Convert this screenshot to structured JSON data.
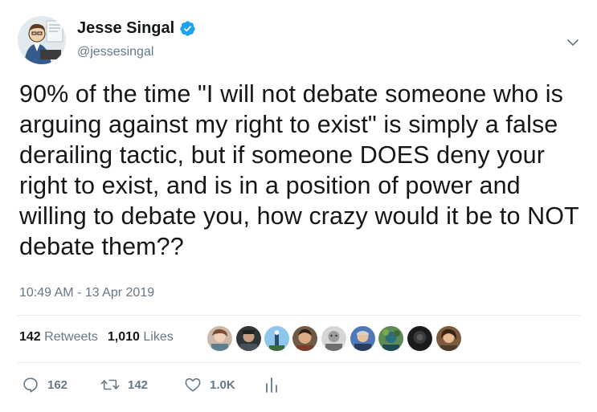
{
  "author": {
    "name": "Jesse Singal",
    "handle": "@jessesingal",
    "verified": true
  },
  "tweet": {
    "text": "90% of the time \"I will not debate someone who is arguing against my right to exist\" is simply a false derailing tactic, but if someone DOES deny your right to exist, and is in a position of power and willing to debate you, how crazy would it be to NOT debate them??",
    "timestamp": "10:49 AM - 13 Apr 2019"
  },
  "stats": {
    "retweets_count": "142",
    "retweets_label": "Retweets",
    "likes_count": "1,010",
    "likes_label": "Likes"
  },
  "liker_avatars": [
    "avatar-1",
    "avatar-2",
    "avatar-3",
    "avatar-4",
    "avatar-5",
    "avatar-6",
    "avatar-7",
    "avatar-8",
    "avatar-9"
  ],
  "actions": {
    "reply_count": "162",
    "retweet_count": "142",
    "like_count": "1.0K"
  },
  "icons": {
    "verified": "verified-badge-icon",
    "menu": "chevron-down-icon",
    "reply": "reply-icon",
    "retweet": "retweet-icon",
    "like": "heart-icon",
    "analytics": "analytics-icon"
  },
  "colors": {
    "text": "#14171a",
    "secondary": "#657786",
    "verified_blue": "#1da1f2",
    "divider": "#e6ecf0"
  }
}
